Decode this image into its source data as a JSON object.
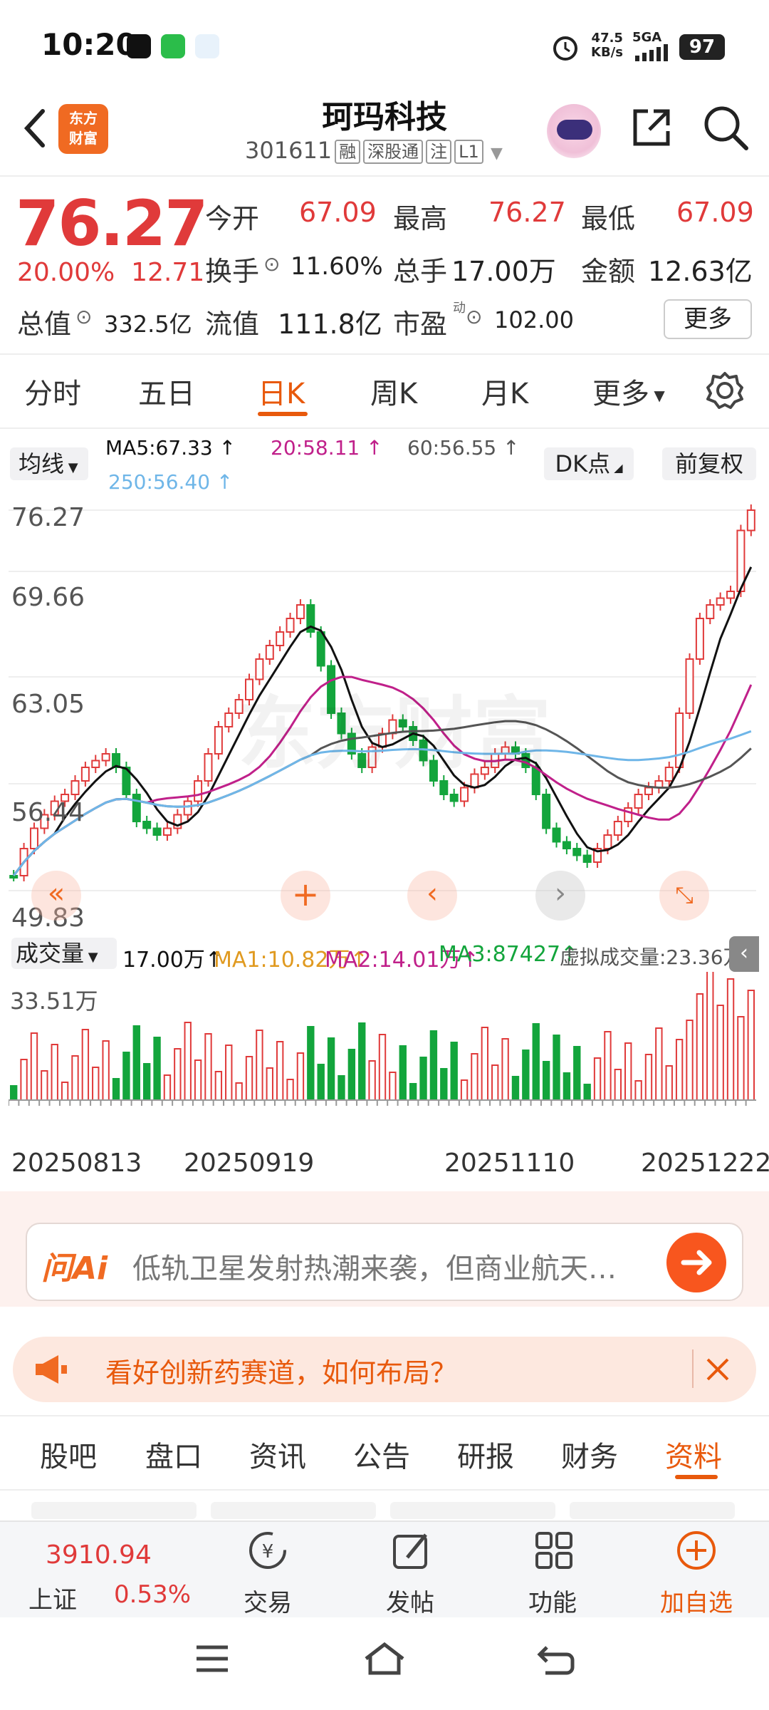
{
  "status": {
    "time": "10:20",
    "netspeed_value": "47.5",
    "netspeed_unit": "KB/s",
    "network": "5GA",
    "battery": "97"
  },
  "header": {
    "brand_logo_line1": "东方",
    "brand_logo_line2": "财富",
    "stock_name": "珂玛科技",
    "stock_code": "301611",
    "tags": [
      "融",
      "深股通",
      "注",
      "L1"
    ]
  },
  "quote": {
    "price": "76.27",
    "change_pct": "20.00%",
    "change_amt": "12.71",
    "open_label": "今开",
    "open": "67.09",
    "high_label": "最高",
    "high": "76.27",
    "low_label": "最低",
    "low": "67.09",
    "turnover_label": "换手",
    "turnover": "11.60%",
    "volume_label": "总手",
    "volume": "17.00万",
    "amount_label": "金额",
    "amount": "12.63亿",
    "mktcap_label": "总值",
    "mktcap": "332.5亿",
    "float_label": "流值",
    "float": "111.8亿",
    "pe_label": "市盈",
    "pe_sup": "动",
    "pe": "102.00",
    "more": "更多"
  },
  "ktabs": [
    "分时",
    "五日",
    "日K",
    "周K",
    "月K",
    "更多"
  ],
  "ma": {
    "button": "均线",
    "ma5": "MA5:67.33 ↑",
    "ma20": "20:58.11 ↑",
    "ma60": "60:56.55 ↑",
    "ma250": "250:56.40 ↑",
    "dk": "DK点",
    "fq": "前复权"
  },
  "chart_axis": {
    "top": "76.27",
    "mid1": "69.66",
    "mid2": "63.05",
    "mid3": "56.44",
    "bottom": "49.83",
    "watermark": "东方财富"
  },
  "volume": {
    "selector": "成交量",
    "vol": "17.00万↑",
    "ma1": "MA1:10.82万↑",
    "ma2": "MA2:14.01万↑",
    "ma3": "MA3:87427↑",
    "virtual": "虚拟成交量:23.36万",
    "axis_max": "33.51万"
  },
  "dates": [
    "20250813",
    "20250919",
    "20251110",
    "20251222"
  ],
  "ai": {
    "logo": "问Ai",
    "text": "低轨卫星发射热潮来袭，但商业航天…"
  },
  "promo": {
    "text": "看好创新药赛道，如何布局？"
  },
  "btabs": [
    "股吧",
    "盘口",
    "资讯",
    "公告",
    "研报",
    "财务",
    "资料"
  ],
  "nav": {
    "index_value": "3910.94",
    "index_name": "上证",
    "index_change": "0.53%",
    "trade": "交易",
    "post": "发帖",
    "func": "功能",
    "add": "加自选"
  },
  "colors": {
    "up": "#e03a3a",
    "down": "#13a53c",
    "accent": "#e8590c",
    "ma5": "#111111",
    "ma20": "#c0208a",
    "ma60": "#555555",
    "ma250": "#6fb6e8"
  }
}
